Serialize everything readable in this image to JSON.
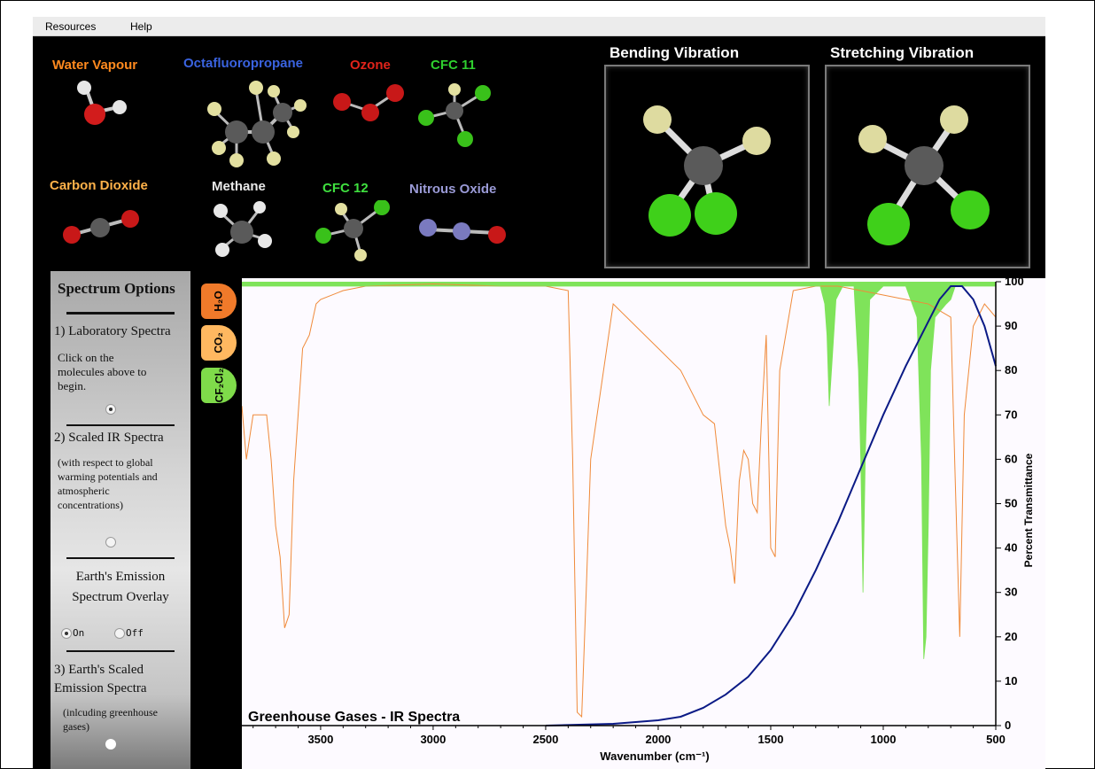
{
  "menu": [
    "Resources",
    "Help"
  ],
  "molecules": [
    {
      "label": "Water Vapour",
      "color": "#ff8a1e"
    },
    {
      "label": "Octafluoropropane",
      "color": "#3a63e0"
    },
    {
      "label": "Ozone",
      "color": "#e0231a"
    },
    {
      "label": "CFC 11",
      "color": "#2fd02f"
    },
    {
      "label": "Carbon Dioxide",
      "color": "#ffb24a"
    },
    {
      "label": "Methane",
      "color": "#e8e8e8"
    },
    {
      "label": "CFC 12",
      "color": "#3fe03f"
    },
    {
      "label": "Nitrous Oxide",
      "color": "#9a9ad6"
    }
  ],
  "vibrations": {
    "bending": "Bending Vibration",
    "stretching": "Stretching Vibration"
  },
  "options": {
    "title": "Spectrum Options",
    "lab": "1) Laboratory Spectra",
    "lab_hint": [
      "Click on the",
      "molecules above to",
      "begin."
    ],
    "scaled": "2) Scaled IR Spectra",
    "scaled_hint": [
      "(with respect to global",
      "warming potentials and",
      "atmospheric",
      "concentrations)"
    ],
    "emission": [
      "Earth's Emission",
      "Spectrum Overlay"
    ],
    "on_label": "On",
    "off_label": "Off",
    "earth_scaled": [
      "3)  Earth's Scaled",
      "Emission Spectra"
    ],
    "earth_hint": [
      "(inlcuding greenhouse",
      "gases)"
    ]
  },
  "tabs": [
    {
      "label": "H₂O",
      "color": "#f07a2a"
    },
    {
      "label": "CO₂",
      "color": "#ffb860"
    },
    {
      "label": "CF₂Cl₂",
      "color": "#7fdb4a"
    }
  ],
  "chart_data": {
    "type": "line",
    "title": "Greenhouse Gases - IR Spectra",
    "xlabel": "Wavenumber (cm⁻¹)",
    "ylabel": "Percent Transmittance",
    "xlim": [
      3850,
      500
    ],
    "ylim": [
      0,
      100
    ],
    "xticks": [
      3500,
      3000,
      2500,
      2000,
      1500,
      1000,
      500
    ],
    "yticks": [
      0,
      10,
      20,
      30,
      40,
      50,
      60,
      70,
      80,
      90,
      100
    ],
    "series": [
      {
        "color": "#f08a3a",
        "x": [
          3850,
          3830,
          3800,
          3780,
          3760,
          3740,
          3720,
          3700,
          3680,
          3660,
          3640,
          3620,
          3600,
          3580,
          3550,
          3520,
          3500,
          3400,
          3300,
          3000,
          2700,
          2500,
          2400,
          2380,
          2360,
          2340,
          2320,
          2300,
          2200,
          2100,
          2000,
          1900,
          1800,
          1750,
          1700,
          1680,
          1660,
          1640,
          1620,
          1600,
          1580,
          1560,
          1540,
          1520,
          1500,
          1480,
          1460,
          1400,
          1300,
          1200,
          1100,
          1000,
          900,
          800,
          700,
          680,
          660,
          640,
          600,
          550,
          500
        ],
        "y": [
          72,
          60,
          70,
          70,
          70,
          70,
          60,
          45,
          38,
          22,
          25,
          55,
          70,
          85,
          88,
          95,
          96,
          98,
          99,
          99.5,
          99,
          99,
          98,
          60,
          3,
          2,
          30,
          60,
          95,
          90,
          85,
          80,
          70,
          68,
          45,
          40,
          32,
          55,
          62,
          60,
          50,
          48,
          70,
          88,
          40,
          38,
          80,
          98,
          99,
          99,
          98,
          97,
          96,
          95,
          92,
          55,
          20,
          70,
          90,
          95,
          92
        ]
      },
      {
        "color": "#7fe35a",
        "x": [
          3850,
          1280,
          1260,
          1250,
          1240,
          1230,
          1210,
          1180,
          1130,
          1110,
          1100,
          1090,
          1080,
          1060,
          1000,
          900,
          850,
          830,
          820,
          810,
          800,
          790,
          770,
          720,
          700,
          680,
          660,
          600,
          500
        ],
        "y": [
          99,
          99,
          95,
          88,
          72,
          80,
          96,
          99,
          99,
          80,
          60,
          30,
          60,
          96,
          99,
          99,
          92,
          60,
          15,
          20,
          45,
          80,
          92,
          95,
          96,
          99,
          99,
          99,
          99
        ]
      },
      {
        "color": "#0b1a86",
        "x": [
          2500,
          2200,
          2000,
          1900,
          1800,
          1700,
          1600,
          1500,
          1400,
          1300,
          1200,
          1100,
          1000,
          900,
          850,
          800,
          750,
          700,
          650,
          600,
          550,
          500
        ],
        "y": [
          0,
          0.4,
          1.2,
          2,
          4,
          7,
          11,
          17,
          25,
          35,
          46,
          58,
          70,
          81,
          86,
          91,
          96,
          99,
          99,
          96,
          90,
          81
        ]
      }
    ]
  }
}
